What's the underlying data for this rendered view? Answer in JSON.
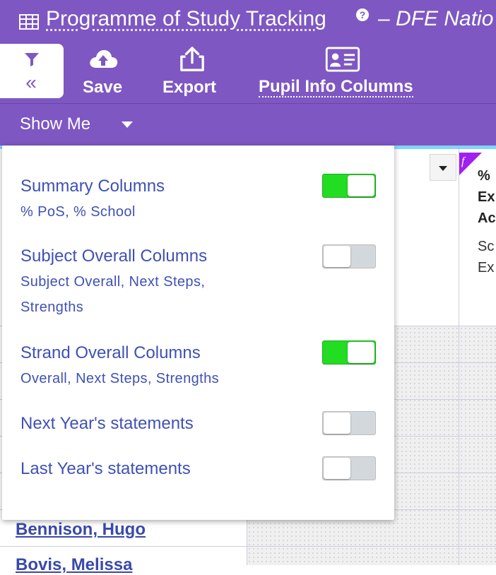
{
  "header": {
    "title": "Programme of Study Tracking",
    "subtitle": "– DFE Natio",
    "help_glyph": "?",
    "collapse_glyph": "«"
  },
  "toolbar": {
    "save_label": "Save",
    "export_label": "Export",
    "pupil_info_label": "Pupil Info Columns"
  },
  "show_me": {
    "label": "Show Me"
  },
  "options": [
    {
      "label": "Summary Columns",
      "description": "% PoS, % School",
      "enabled": true
    },
    {
      "label": "Subject Overall Columns",
      "description": "Subject Overall, Next Steps, Strengths",
      "enabled": false
    },
    {
      "label": "Strand Overall Columns",
      "description": "Overall, Next Steps, Strengths",
      "enabled": true
    },
    {
      "label": "Next Year's statements",
      "description": "",
      "enabled": false
    },
    {
      "label": "Last Year's statements",
      "description": "",
      "enabled": false
    }
  ],
  "grid": {
    "column_header": "%\nEx\nAc",
    "column_subheader": "Sc\nEx",
    "pupils": [
      "Bennison, Hugo",
      "Bovis, Melissa"
    ]
  },
  "colors": {
    "header_bg": "#7e57c2",
    "toggle_on": "#22dd22",
    "toggle_off": "#d3d8dc",
    "link_blue": "#3f51b5",
    "formula_badge": "#a020f0"
  }
}
